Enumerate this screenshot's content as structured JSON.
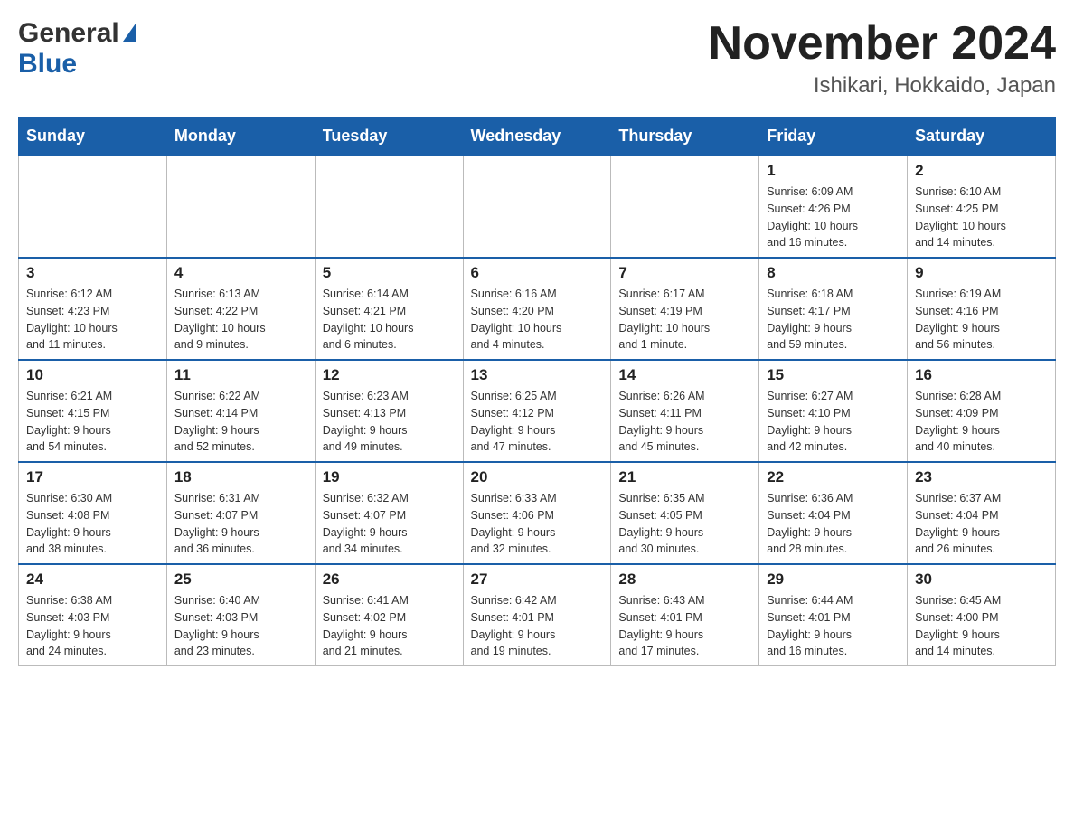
{
  "header": {
    "logo_general": "General",
    "logo_blue": "Blue",
    "month_title": "November 2024",
    "location": "Ishikari, Hokkaido, Japan"
  },
  "weekdays": [
    "Sunday",
    "Monday",
    "Tuesday",
    "Wednesday",
    "Thursday",
    "Friday",
    "Saturday"
  ],
  "weeks": [
    {
      "days": [
        {
          "date": "",
          "info": ""
        },
        {
          "date": "",
          "info": ""
        },
        {
          "date": "",
          "info": ""
        },
        {
          "date": "",
          "info": ""
        },
        {
          "date": "",
          "info": ""
        },
        {
          "date": "1",
          "info": "Sunrise: 6:09 AM\nSunset: 4:26 PM\nDaylight: 10 hours\nand 16 minutes."
        },
        {
          "date": "2",
          "info": "Sunrise: 6:10 AM\nSunset: 4:25 PM\nDaylight: 10 hours\nand 14 minutes."
        }
      ]
    },
    {
      "days": [
        {
          "date": "3",
          "info": "Sunrise: 6:12 AM\nSunset: 4:23 PM\nDaylight: 10 hours\nand 11 minutes."
        },
        {
          "date": "4",
          "info": "Sunrise: 6:13 AM\nSunset: 4:22 PM\nDaylight: 10 hours\nand 9 minutes."
        },
        {
          "date": "5",
          "info": "Sunrise: 6:14 AM\nSunset: 4:21 PM\nDaylight: 10 hours\nand 6 minutes."
        },
        {
          "date": "6",
          "info": "Sunrise: 6:16 AM\nSunset: 4:20 PM\nDaylight: 10 hours\nand 4 minutes."
        },
        {
          "date": "7",
          "info": "Sunrise: 6:17 AM\nSunset: 4:19 PM\nDaylight: 10 hours\nand 1 minute."
        },
        {
          "date": "8",
          "info": "Sunrise: 6:18 AM\nSunset: 4:17 PM\nDaylight: 9 hours\nand 59 minutes."
        },
        {
          "date": "9",
          "info": "Sunrise: 6:19 AM\nSunset: 4:16 PM\nDaylight: 9 hours\nand 56 minutes."
        }
      ]
    },
    {
      "days": [
        {
          "date": "10",
          "info": "Sunrise: 6:21 AM\nSunset: 4:15 PM\nDaylight: 9 hours\nand 54 minutes."
        },
        {
          "date": "11",
          "info": "Sunrise: 6:22 AM\nSunset: 4:14 PM\nDaylight: 9 hours\nand 52 minutes."
        },
        {
          "date": "12",
          "info": "Sunrise: 6:23 AM\nSunset: 4:13 PM\nDaylight: 9 hours\nand 49 minutes."
        },
        {
          "date": "13",
          "info": "Sunrise: 6:25 AM\nSunset: 4:12 PM\nDaylight: 9 hours\nand 47 minutes."
        },
        {
          "date": "14",
          "info": "Sunrise: 6:26 AM\nSunset: 4:11 PM\nDaylight: 9 hours\nand 45 minutes."
        },
        {
          "date": "15",
          "info": "Sunrise: 6:27 AM\nSunset: 4:10 PM\nDaylight: 9 hours\nand 42 minutes."
        },
        {
          "date": "16",
          "info": "Sunrise: 6:28 AM\nSunset: 4:09 PM\nDaylight: 9 hours\nand 40 minutes."
        }
      ]
    },
    {
      "days": [
        {
          "date": "17",
          "info": "Sunrise: 6:30 AM\nSunset: 4:08 PM\nDaylight: 9 hours\nand 38 minutes."
        },
        {
          "date": "18",
          "info": "Sunrise: 6:31 AM\nSunset: 4:07 PM\nDaylight: 9 hours\nand 36 minutes."
        },
        {
          "date": "19",
          "info": "Sunrise: 6:32 AM\nSunset: 4:07 PM\nDaylight: 9 hours\nand 34 minutes."
        },
        {
          "date": "20",
          "info": "Sunrise: 6:33 AM\nSunset: 4:06 PM\nDaylight: 9 hours\nand 32 minutes."
        },
        {
          "date": "21",
          "info": "Sunrise: 6:35 AM\nSunset: 4:05 PM\nDaylight: 9 hours\nand 30 minutes."
        },
        {
          "date": "22",
          "info": "Sunrise: 6:36 AM\nSunset: 4:04 PM\nDaylight: 9 hours\nand 28 minutes."
        },
        {
          "date": "23",
          "info": "Sunrise: 6:37 AM\nSunset: 4:04 PM\nDaylight: 9 hours\nand 26 minutes."
        }
      ]
    },
    {
      "days": [
        {
          "date": "24",
          "info": "Sunrise: 6:38 AM\nSunset: 4:03 PM\nDaylight: 9 hours\nand 24 minutes."
        },
        {
          "date": "25",
          "info": "Sunrise: 6:40 AM\nSunset: 4:03 PM\nDaylight: 9 hours\nand 23 minutes."
        },
        {
          "date": "26",
          "info": "Sunrise: 6:41 AM\nSunset: 4:02 PM\nDaylight: 9 hours\nand 21 minutes."
        },
        {
          "date": "27",
          "info": "Sunrise: 6:42 AM\nSunset: 4:01 PM\nDaylight: 9 hours\nand 19 minutes."
        },
        {
          "date": "28",
          "info": "Sunrise: 6:43 AM\nSunset: 4:01 PM\nDaylight: 9 hours\nand 17 minutes."
        },
        {
          "date": "29",
          "info": "Sunrise: 6:44 AM\nSunset: 4:01 PM\nDaylight: 9 hours\nand 16 minutes."
        },
        {
          "date": "30",
          "info": "Sunrise: 6:45 AM\nSunset: 4:00 PM\nDaylight: 9 hours\nand 14 minutes."
        }
      ]
    }
  ]
}
